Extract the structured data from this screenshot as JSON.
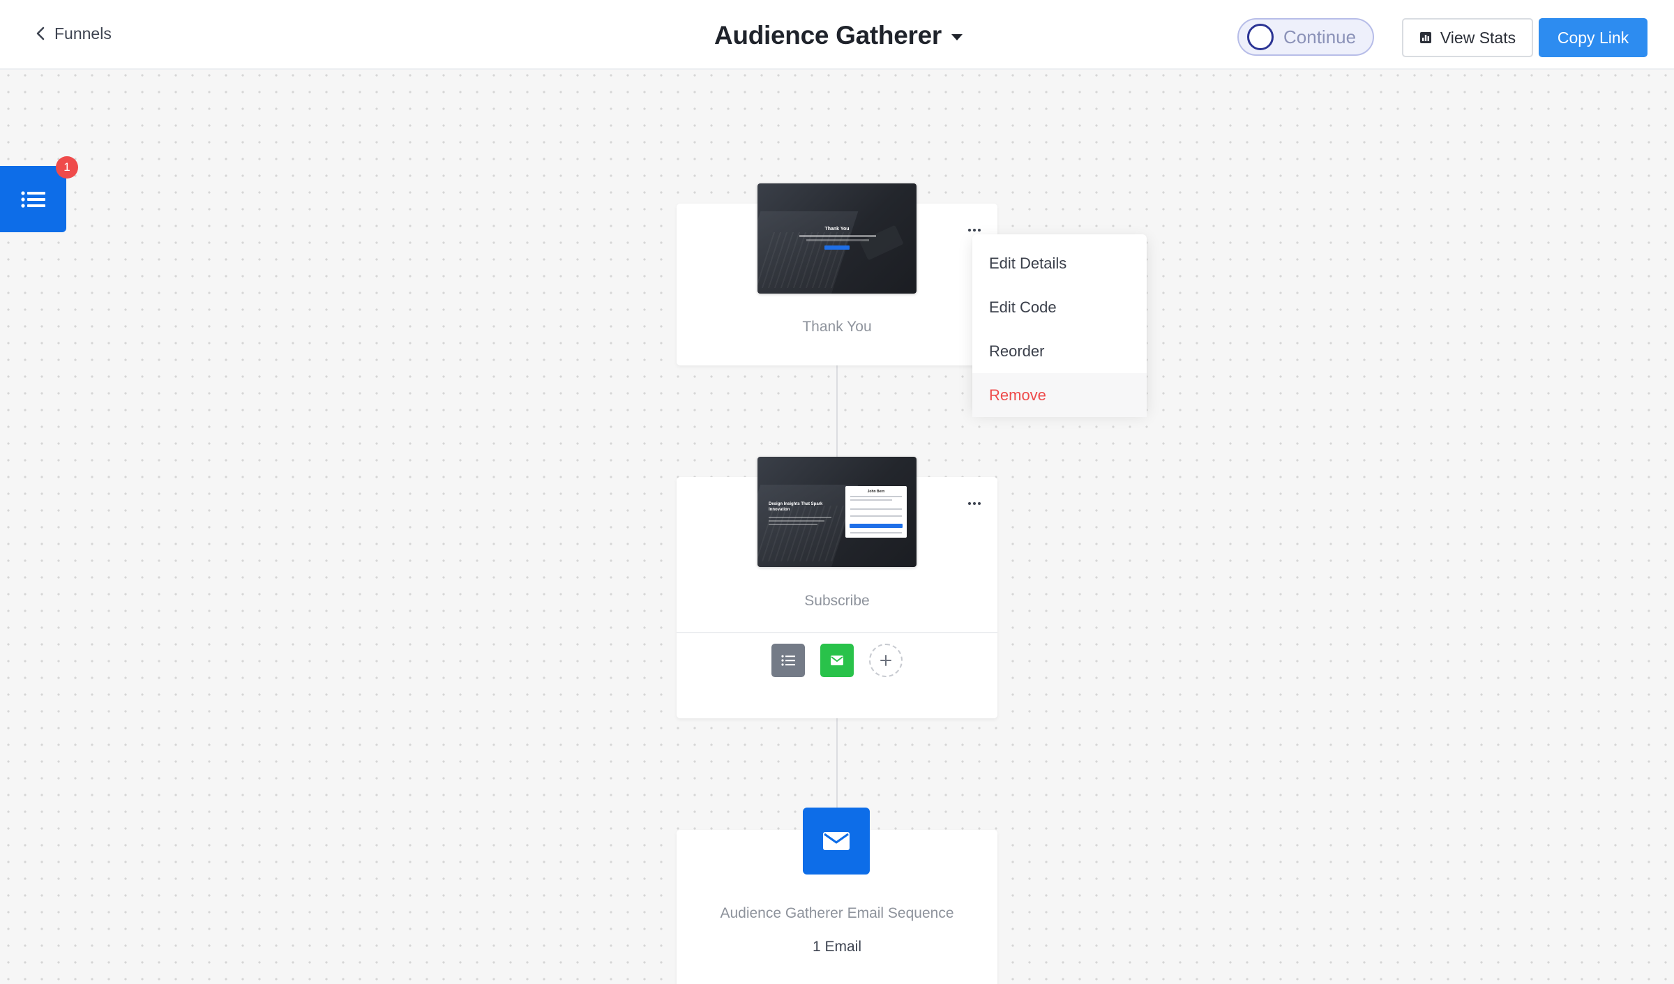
{
  "header": {
    "back_label": "Funnels",
    "funnel_title": "Audience Gatherer",
    "toggle_label": "Continue",
    "view_stats_label": "View Stats",
    "copy_link_label": "Copy Link"
  },
  "sidebar_toggle": {
    "badge_count": "1"
  },
  "steps": [
    {
      "name": "Thank You",
      "thumbnail_heading": "Thank You"
    },
    {
      "name": "Subscribe",
      "thumbnail_headline": "Design Insights That Spark Innovation",
      "thumbnail_form_name": "John Bern"
    }
  ],
  "step_menu": {
    "items": [
      "Edit Details",
      "Edit Code",
      "Reorder",
      "Remove"
    ]
  },
  "email_sequence": {
    "name": "Audience Gatherer Email Sequence",
    "count_label": "1 Email"
  },
  "colors": {
    "primary": "#2d8cf0",
    "accent_blue": "#0d6de8",
    "danger": "#ee4b4b",
    "email_green": "#29c24a"
  }
}
